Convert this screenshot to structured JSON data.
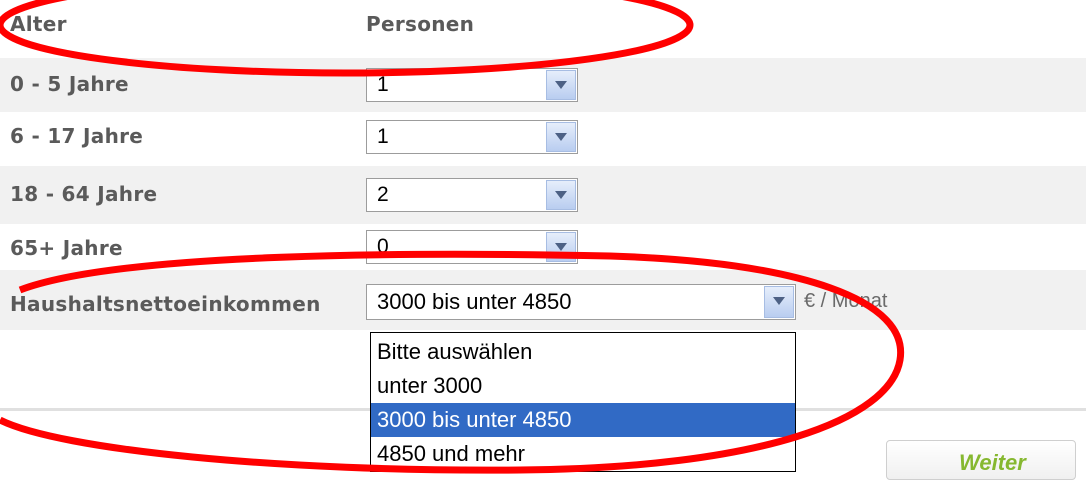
{
  "header": {
    "col_age": "Alter",
    "col_persons": "Personen"
  },
  "rows": [
    {
      "label": "0 - 5 Jahre",
      "value": "1"
    },
    {
      "label": "6 - 17 Jahre",
      "value": "1"
    },
    {
      "label": "18 - 64 Jahre",
      "value": "2"
    },
    {
      "label": "65+ Jahre",
      "value": "0"
    }
  ],
  "income": {
    "label": "Haushaltsnettoeinkommen",
    "selected": "3000 bis unter 4850",
    "unit": "€ / Monat",
    "options": [
      "Bitte auswählen",
      "unter 3000",
      "3000 bis unter 4850",
      "4850 und mehr"
    ],
    "selected_index": 2
  },
  "buttons": {
    "next": "Weiter"
  },
  "colors": {
    "annotation": "#ff0000",
    "selection": "#316ac5",
    "button_text": "#86b830"
  }
}
